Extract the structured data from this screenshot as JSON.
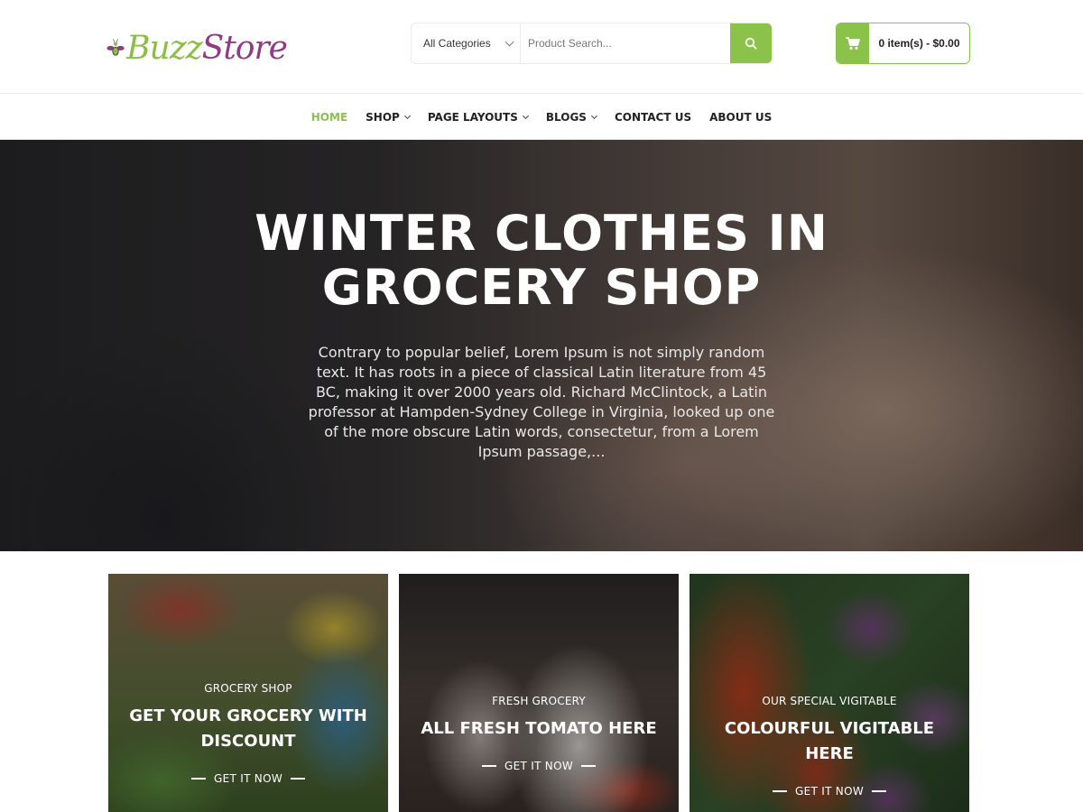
{
  "brand": {
    "name_part1": "Buzz",
    "name_part2": "Store",
    "accent_color": "#8bc34a",
    "secondary_color": "#8e3b84"
  },
  "search": {
    "category_selected": "All Categories",
    "placeholder": "Product Search...",
    "button_icon": "search-icon"
  },
  "cart": {
    "icon": "cart-icon",
    "summary": "0 item(s) - $0.00"
  },
  "nav": {
    "items": [
      {
        "label": "HOME",
        "active": true
      },
      {
        "label": "SHOP",
        "dropdown": true
      },
      {
        "label": "PAGE LAYOUTS",
        "dropdown": true
      },
      {
        "label": "BLOGS",
        "dropdown": true
      },
      {
        "label": "CONTACT US"
      },
      {
        "label": "ABOUT US"
      }
    ]
  },
  "hero": {
    "title_line1": "WINTER CLOTHES IN",
    "title_line2": "GROCERY SHOP",
    "text": "Contrary to popular belief, Lorem Ipsum is not simply random text. It has roots in a piece of classical Latin literature from 45 BC, making it over 2000 years old. Richard McClintock, a Latin professor at Hampden-Sydney College in Virginia, looked up one of the more obscure Latin words, consectetur, from a Lorem Ipsum passage,..."
  },
  "cards": [
    {
      "eyebrow": "GROCERY SHOP",
      "title": "GET YOUR GROCERY WITH DISCOUNT",
      "cta": "GET IT NOW"
    },
    {
      "eyebrow": "FRESH GROCERY",
      "title": "ALL FRESH TOMATO HERE",
      "cta": "GET IT NOW"
    },
    {
      "eyebrow": "OUR SPECIAL VIGITABLE",
      "title": "COLOURFUL VIGITABLE HERE",
      "cta": "GET IT NOW"
    }
  ]
}
